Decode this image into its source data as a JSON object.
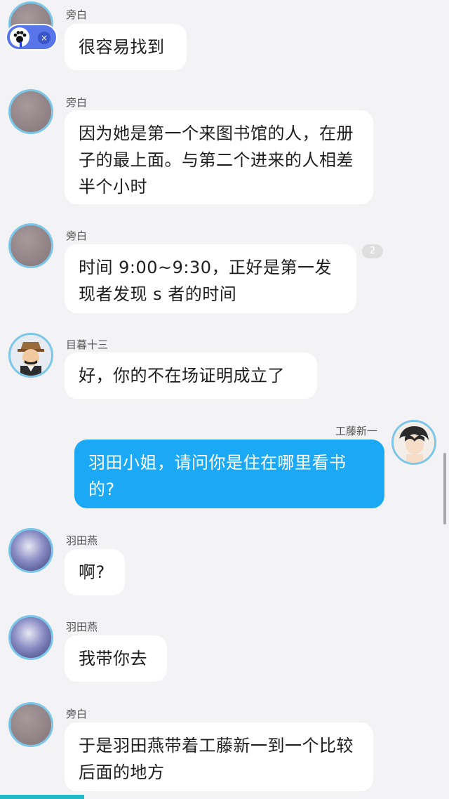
{
  "messages": [
    {
      "sender": "旁白",
      "text": "很容易找到"
    },
    {
      "sender": "旁白",
      "text": "因为她是第一个来图书馆的人，在册子的最上面。与第二个进来的人相差半个小时"
    },
    {
      "sender": "旁白",
      "text": "时间 9:00~9:30，正好是第一发现者发现 s 者的时间",
      "badge": "2"
    },
    {
      "sender": "目暮十三",
      "text": "好，你的不在场证明成立了"
    },
    {
      "sender": "工藤新一",
      "text": "羽田小姐，请问你是住在哪里看书的?"
    },
    {
      "sender": "羽田燕",
      "text": "啊?"
    },
    {
      "sender": "羽田燕",
      "text": "我带你去"
    },
    {
      "sender": "旁白",
      "text": "于是羽田燕带着工藤新一到一个比较后面的地方"
    }
  ],
  "mini_player": {
    "close_icon": "×"
  },
  "colors": {
    "accent": "#1ba9f5",
    "avatar_ring": "#7cc6ea",
    "background": "#f3f3f5"
  }
}
